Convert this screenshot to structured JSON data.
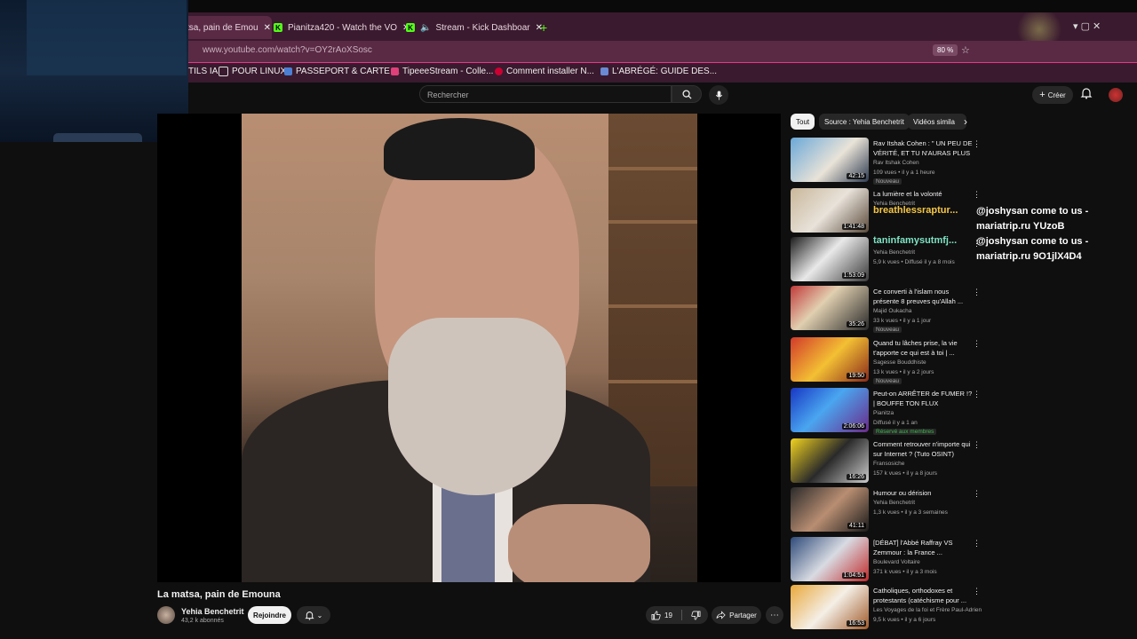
{
  "browser": {
    "tabs": [
      {
        "label": "tsa, pain de Emou"
      },
      {
        "label": "Pianitza420 - Watch the VO"
      },
      {
        "label": "Stream - Kick Dashboar"
      }
    ],
    "new_tab": "+",
    "url": "www.youtube.com/watch?v=OY2rAoXSosc",
    "zoom": "80 %",
    "bookmarks": [
      {
        "label": "TILS IA"
      },
      {
        "label": "POUR LINUX"
      },
      {
        "label": "PASSEPORT & CARTE ..."
      },
      {
        "label": "TipeeeStream - Colle..."
      },
      {
        "label": "Comment installer N..."
      },
      {
        "label": "L'ABRÉGÉ: GUIDE DES..."
      }
    ]
  },
  "header": {
    "search_placeholder": "Rechercher",
    "create_label": "Créer"
  },
  "video": {
    "title": "La matsa, pain de Emouna",
    "channel": "Yehia Benchetrit",
    "subscribers": "43,2 k abonnés",
    "join_label": "Rejoindre",
    "likes": "19",
    "share_label": "Partager"
  },
  "chips": [
    {
      "label": "Tout"
    },
    {
      "label": "Source : Yehia Benchetrit"
    },
    {
      "label": "Vidéos simila"
    }
  ],
  "recommendations": [
    {
      "title": "Rav Itshak Cohen : \" UN PEU DE VÉRITÉ, ET TU N'AURAS PLUS ...",
      "channel": "Rav Itshak Cohen",
      "meta": "109 vues • il y a 1 heure",
      "badge": "Nouveau",
      "duration": "42:15"
    },
    {
      "title": "La lumière et la volonté",
      "channel": "Yehia Benchetrit",
      "meta": "",
      "badge": "",
      "duration": "1:41:48"
    },
    {
      "title": "",
      "channel": "Yehia Benchetrit",
      "meta": "5,9 k vues • Diffusé il y a 8 mois",
      "badge": "",
      "duration": "1:53:09"
    },
    {
      "title": "Ce converti à l'islam nous présente 8 preuves qu'Allah ...",
      "channel": "Majid Oukacha",
      "meta": "33 k vues • il y a 1 jour",
      "badge": "Nouveau",
      "duration": "35:26"
    },
    {
      "title": "Quand tu lâches prise, la vie t'apporte ce qui est à toi | ...",
      "channel": "Sagesse Bouddhiste",
      "meta": "13 k vues • il y a 2 jours",
      "badge": "Nouveau",
      "duration": "19:50"
    },
    {
      "title": "Peut-on ARRÊTER de FUMER !? | BOUFFE TON FLUX",
      "channel": "Pianitza",
      "meta": "Diffusé il y a 1 an",
      "badge": "Réservé aux membres",
      "duration": "2:06:06"
    },
    {
      "title": "Comment retrouver n'importe qui sur Internet ? (Tuto OSINT)",
      "channel": "Fransosiche",
      "meta": "157 k vues • il y a 8 jours",
      "badge": "",
      "duration": "16:26"
    },
    {
      "title": "Humour ou dérision",
      "channel": "Yehia Benchetrit",
      "meta": "1,3 k vues • il y a 3 semaines",
      "badge": "",
      "duration": "41:11"
    },
    {
      "title": "[DÉBAT] l'Abbé Raffray VS Zemmour : la France ...",
      "channel": "Boulevard Voltaire",
      "meta": "371 k vues • il y a 3 mois",
      "badge": "",
      "duration": "1:04:51"
    },
    {
      "title": "Catholiques, orthodoxes et protestants (catéchisme pour ...",
      "channel": "Les Voyages de la foi et Frère Paul-Adrien",
      "meta": "9,5 k vues • il y a 6 jours",
      "badge": "",
      "duration": "16:53"
    }
  ],
  "chat": [
    {
      "user": "breathlessraptur...",
      "color": "#f6c744",
      "message": "@joshysan come to us - mariatrip.ru YUzoB"
    },
    {
      "user": "taninfamysutmfj...",
      "color": "#7fe3c4",
      "message": "@joshysan come to us - mariatrip.ru 9O1jlX4D4"
    }
  ]
}
